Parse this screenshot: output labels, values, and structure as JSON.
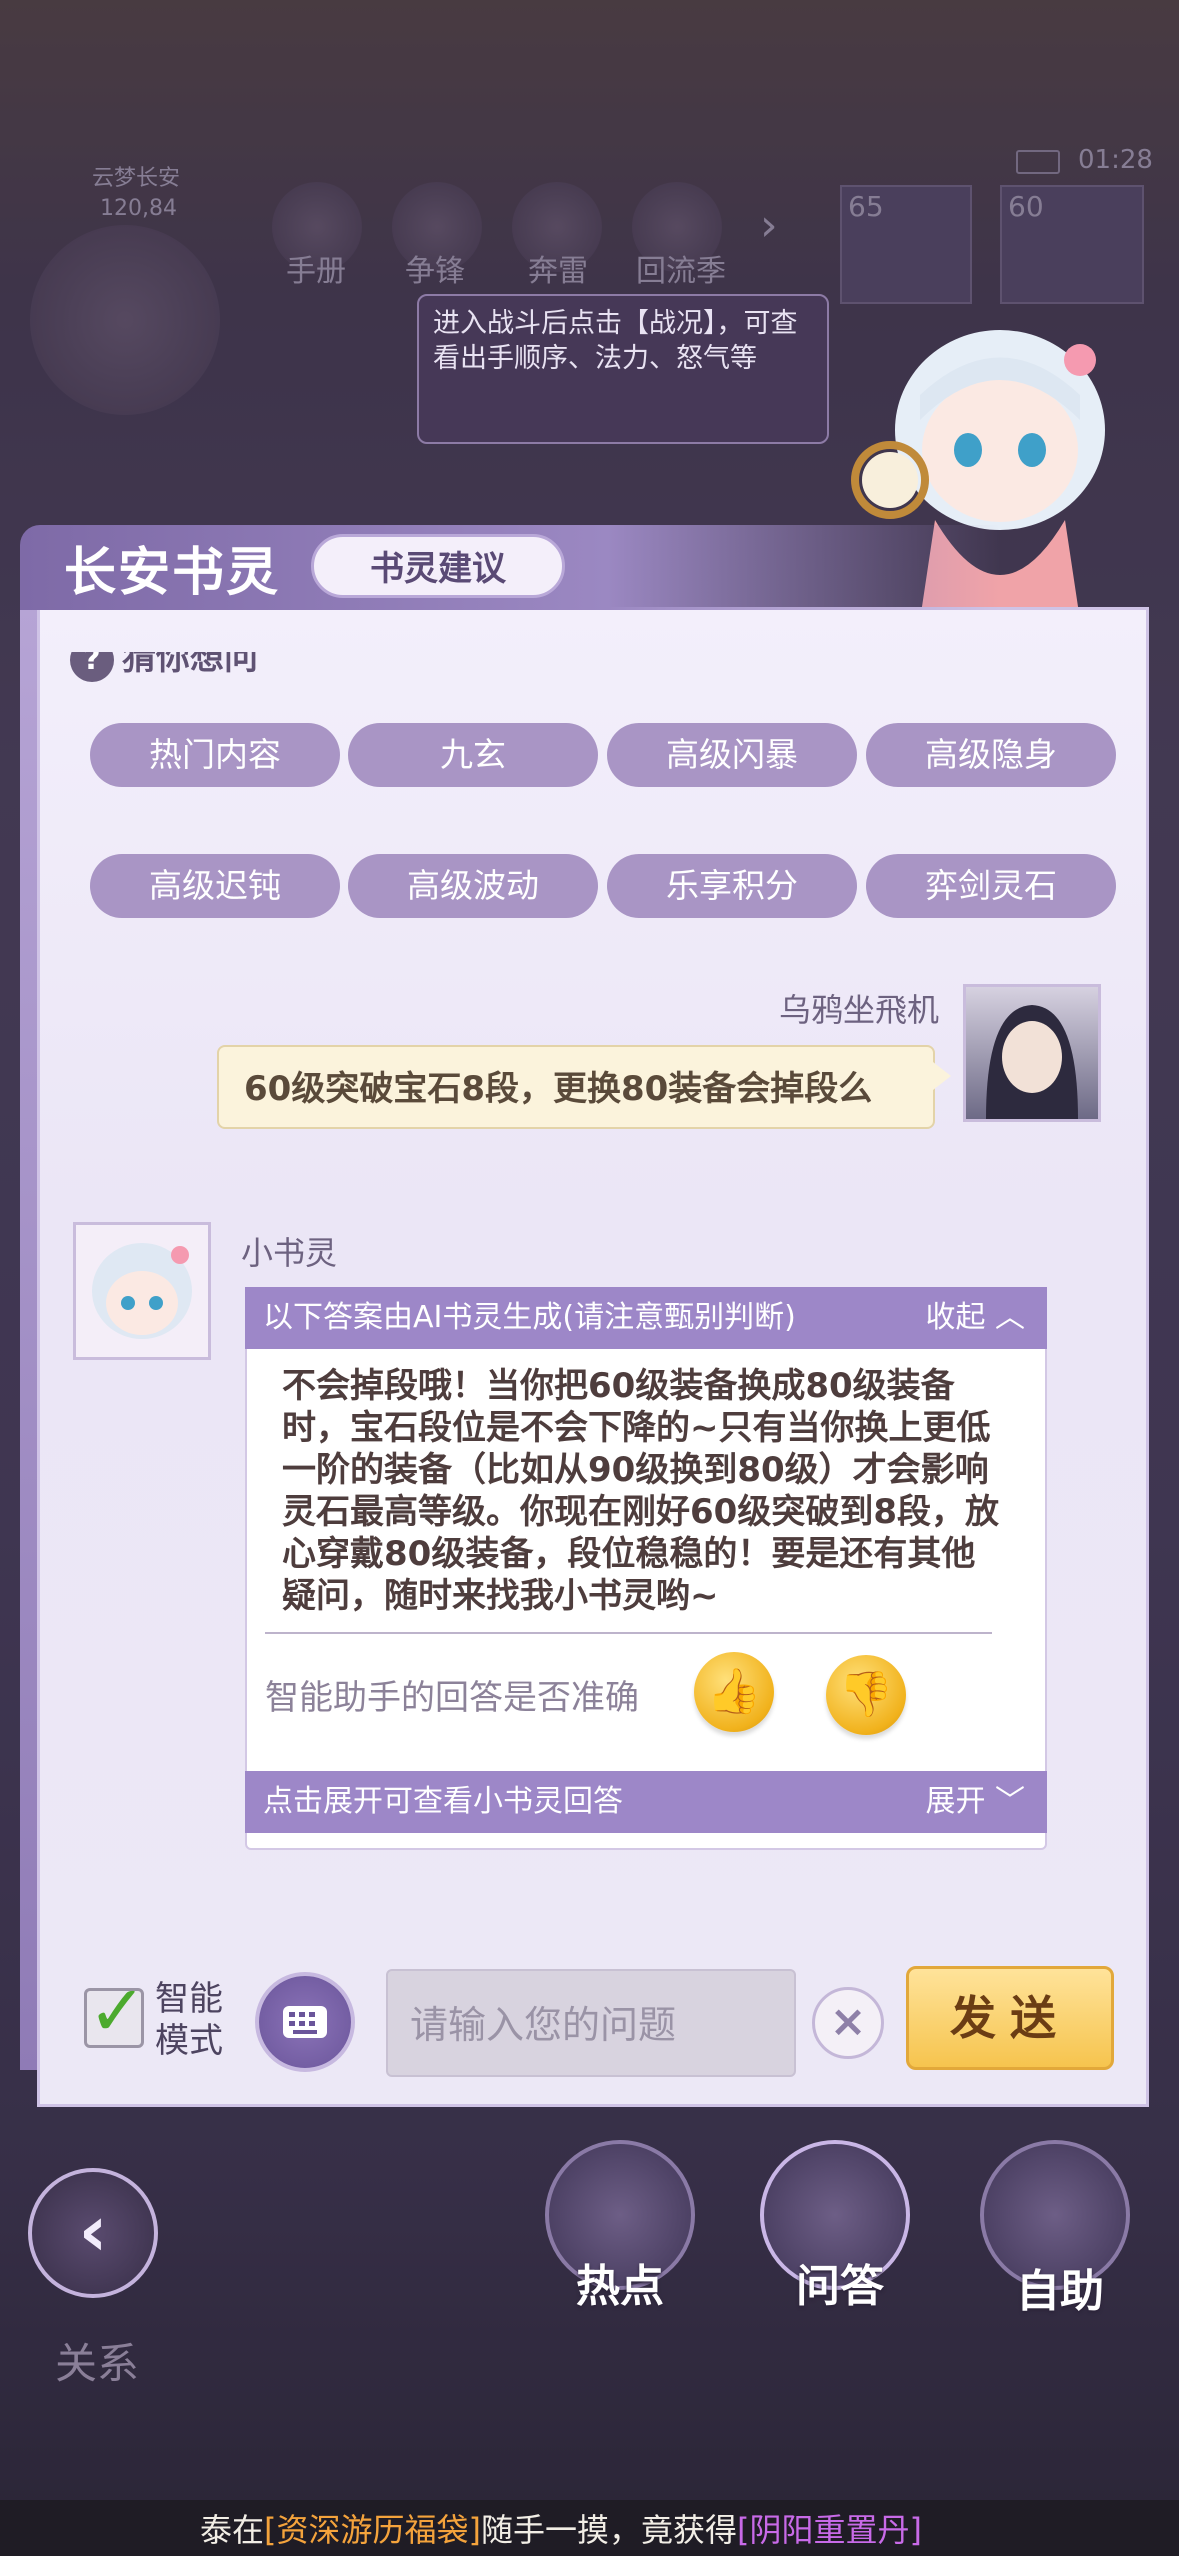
{
  "hud": {
    "location": "云梦长安",
    "coords": "120,84",
    "time": "01:28",
    "menu": [
      "手册",
      "争锋",
      "奔雷",
      "回流季"
    ],
    "levels": [
      "65",
      "60"
    ]
  },
  "tooltip": {
    "text": "进入战斗后点击【战况】，可查看出手顺序、法力、怒气等"
  },
  "panel": {
    "title": "长安书灵",
    "tab": "书灵建议",
    "section_hint": "猜你想问",
    "chips": [
      "热门内容",
      "九玄",
      "高级闪暴",
      "高级隐身",
      "高级迟钝",
      "高级波动",
      "乐享积分",
      "弈剑灵石"
    ]
  },
  "chat": {
    "user_name": "乌鸦坐飛机",
    "user_message": "60级突破宝石8段，更换80装备会掉段么",
    "bot_name": "小书灵",
    "ai_header": "以下答案由AI书灵生成(请注意甄别判断)",
    "collapse_label": "收起",
    "answer": "不会掉段哦！当你把60级装备换成80级装备时，宝石段位是不会下降的~只有当你换上更低一阶的装备（比如从90级换到80级）才会影响灵石最高等级。你现在刚好60级突破到8段，放心穿戴80级装备，段位稳稳的！要是还有其他疑问，随时来找我小书灵哟~",
    "feedback_label": "智能助手的回答是否准确",
    "expand_hint": "点击展开可查看小书灵回答",
    "expand_label": "展开"
  },
  "input_bar": {
    "smart_mode_label": "智能模式",
    "placeholder": "请输入您的问题",
    "send_label": "发送"
  },
  "nav": {
    "back_label": "关系",
    "items": [
      "热点",
      "问答",
      "自助"
    ]
  },
  "ticker": {
    "prefix": "泰在",
    "item1": "[资深游历福袋]",
    "middle": "随手一摸，竟获得",
    "item2": "[阴阳重置丹]"
  }
}
